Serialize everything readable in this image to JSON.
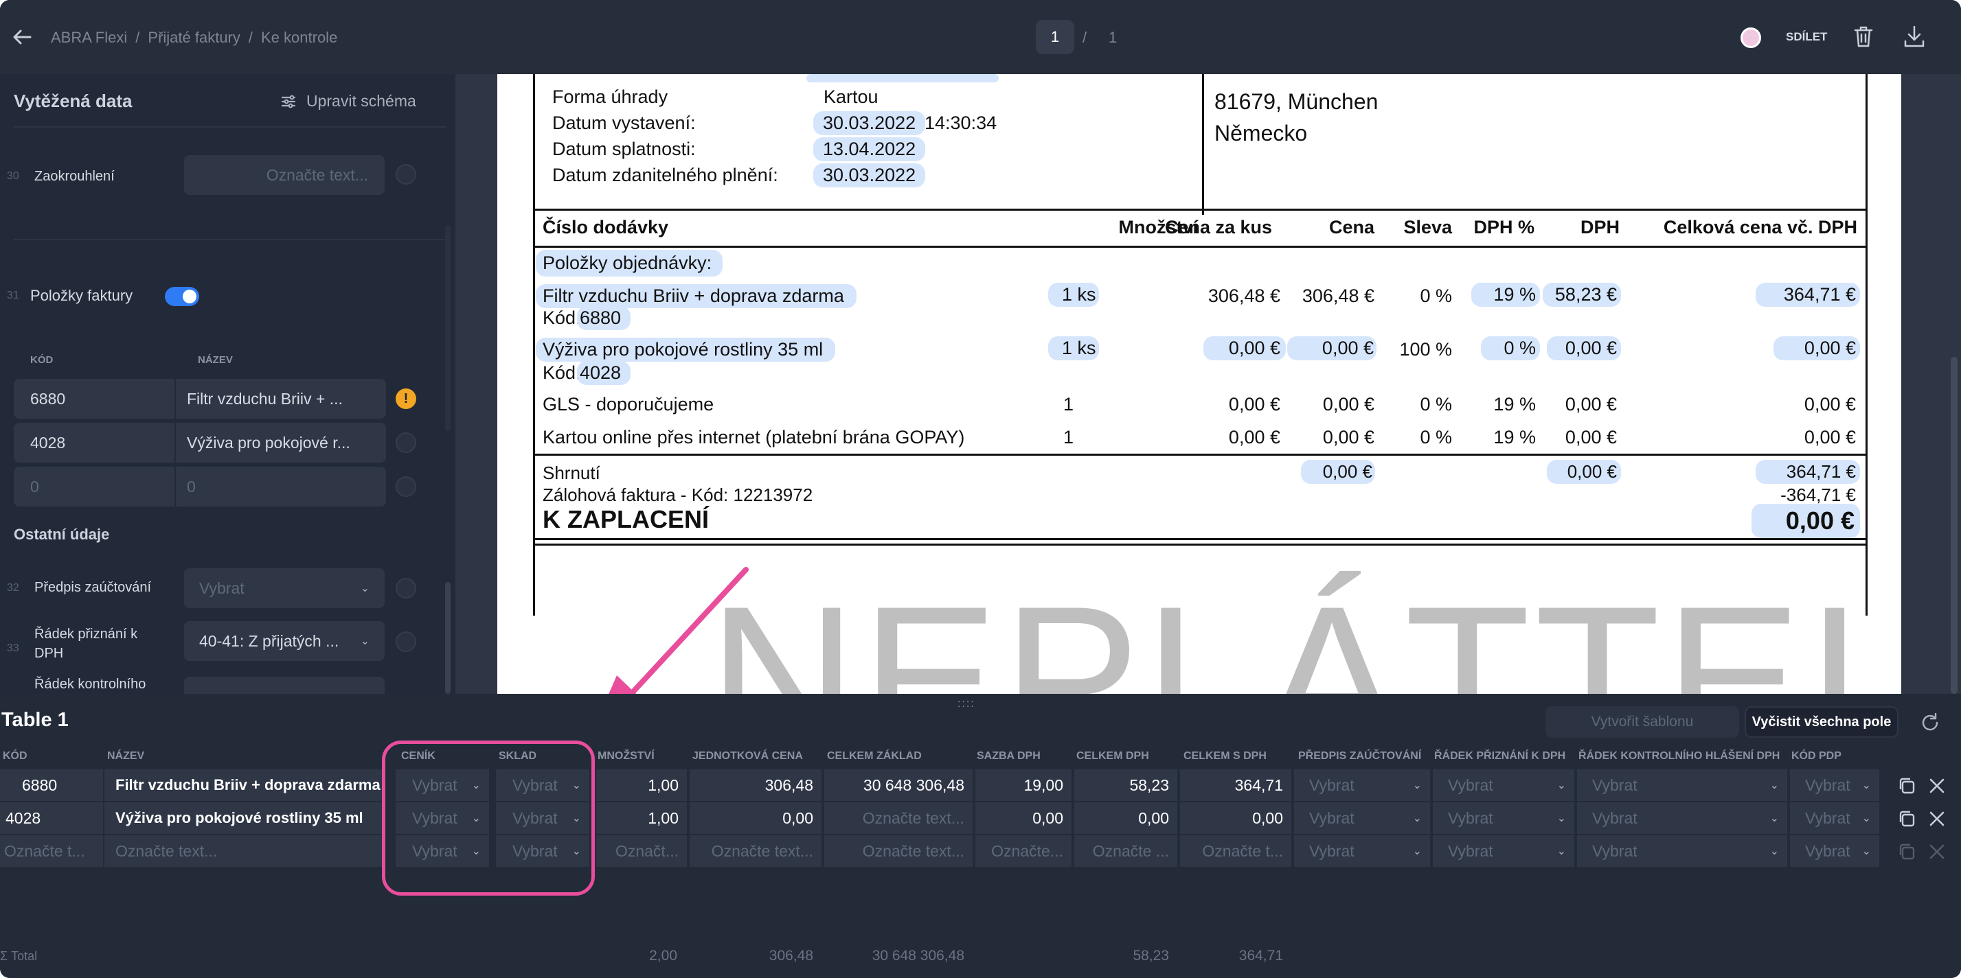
{
  "header": {
    "breadcrumb": [
      "ABRA Flexi",
      "Přijaté faktury",
      "Ke kontrole"
    ],
    "breadcrumb_sep": "/",
    "page_current": "1",
    "page_sep": "/",
    "page_total": "1",
    "share_label": "SDÍLET",
    "icons": [
      "back-arrow-icon",
      "user-avatar-icon",
      "trash-icon",
      "download-icon"
    ]
  },
  "sidebar": {
    "title": "Vytěžená data",
    "edit_schema": "Upravit schéma",
    "rounding": {
      "num": "30",
      "label": "Zaokrouhlení",
      "placeholder": "Označte text..."
    },
    "items_section": {
      "num": "31",
      "label": "Položky faktury",
      "toggle_on": true
    },
    "items_headers": {
      "code": "KÓD",
      "name": "NÁZEV"
    },
    "items": [
      {
        "code": "6880",
        "name": "Filtr vzduchu Briiv + ...",
        "warning": "!"
      },
      {
        "code": "4028",
        "name": "Výživa pro pokojové r..."
      },
      {
        "code": "0",
        "name": "0"
      }
    ],
    "other_title": "Ostatní údaje",
    "accounting": {
      "num": "32",
      "label": "Předpis zaúčtování",
      "value": "Vybrat"
    },
    "vat_line": {
      "num": "33",
      "label": "Řádek přiznání k DPH",
      "value": "40-41: Z přijatých ..."
    },
    "control_line": {
      "label": "Řádek kontrolního"
    }
  },
  "document": {
    "payment_method_label": "Forma úhrady",
    "payment_method": "Kartou",
    "issue_label": "Datum vystavení:",
    "issue_date": "30.03.2022",
    "issue_time": "14:30:34",
    "due_label": "Datum splatnosti:",
    "due_date": "13.04.2022",
    "taxable_label": "Datum zdanitelného plnění:",
    "taxable_date": "30.03.2022",
    "address_city": "81679, München",
    "address_country": "Německo",
    "table_headers": [
      "Číslo dodávky",
      "Množství",
      "Cena za kus",
      "Cena",
      "Sleva",
      "DPH %",
      "DPH",
      "Celková cena vč. DPH"
    ],
    "section_label": "Položky objednávky:",
    "rows": [
      {
        "name": "Filtr vzduchu Briiv + doprava zdarma",
        "code_label": "Kód:",
        "code": "6880",
        "qty": "1 ks",
        "unit": "306,48 €",
        "price": "306,48 €",
        "discount": "0 %",
        "vat_pct": "19 %",
        "vat": "58,23 €",
        "total": "364,71 €"
      },
      {
        "name": "Výživa pro pokojové rostliny 35 ml",
        "code_label": "Kód:",
        "code": "4028",
        "qty": "1 ks",
        "unit": "0,00 €",
        "price": "0,00 €",
        "discount": "100 %",
        "vat_pct": "0 %",
        "vat": "0,00 €",
        "total": "0,00 €"
      },
      {
        "name": "GLS - doporučujeme",
        "qty": "1",
        "unit": "0,00 €",
        "price": "0,00 €",
        "discount": "0 %",
        "vat_pct": "19 %",
        "vat": "0,00 €",
        "total": "0,00 €"
      },
      {
        "name": "Kartou online přes internet (platební brána GOPAY)",
        "qty": "1",
        "unit": "0,00 €",
        "price": "0,00 €",
        "discount": "0 %",
        "vat_pct": "19 %",
        "vat": "0,00 €",
        "total": "0,00 €"
      }
    ],
    "summary_label": "Shrnutí",
    "summary_price": "0,00 €",
    "summary_vat": "0,00 €",
    "summary_total": "364,71 €",
    "advance_label": "Zálohová faktura - Kód: 12213972",
    "advance_total": "-364,71 €",
    "pay_label": "K ZAPLACENÍ",
    "pay_total": "0,00 €",
    "watermark": "NEPLÁTTEI"
  },
  "resize_handle": "::::",
  "table": {
    "title": "Table 1",
    "create_template": "Vytvořit šablonu",
    "clear_all": "Vyčistit všechna pole",
    "columns": [
      "KÓD",
      "NÁZEV",
      "CENÍK",
      "SKLAD",
      "MNOŽSTVÍ",
      "JEDNOTKOVÁ CENA",
      "CELKEM ZÁKLAD",
      "SAZBA DPH",
      "CELKEM DPH",
      "CELKEM S DPH",
      "PŘEDPIS ZAÚČTOVÁNÍ",
      "ŘÁDEK PŘIZNÁNÍ K DPH",
      "ŘÁDEK KONTROLNÍHO HLÁŠENÍ DPH",
      "KÓD PDP"
    ],
    "rows": [
      {
        "code": "6880",
        "name": "Filtr vzduchu Briiv + doprava zdarma",
        "cenik": "Vybrat",
        "sklad": "Vybrat",
        "qty": "1,00",
        "unit": "306,48",
        "base": "30 648 306,48",
        "rate": "19,00",
        "vat": "58,23",
        "total": "364,71",
        "acc": "Vybrat",
        "vatline": "Vybrat",
        "ctrl": "Vybrat",
        "pdp": "Vybrat"
      },
      {
        "code": "4028",
        "name": "Výživa pro pokojové rostliny 35 ml",
        "cenik": "Vybrat",
        "sklad": "Vybrat",
        "qty": "1,00",
        "unit": "0,00",
        "base": "Označte text...",
        "rate": "0,00",
        "vat": "0,00",
        "total": "0,00",
        "acc": "Vybrat",
        "vatline": "Vybrat",
        "ctrl": "Vybrat",
        "pdp": "Vybrat"
      },
      {
        "code": "Označte t...",
        "name": "Označte text...",
        "cenik": "Vybrat",
        "sklad": "Vybrat",
        "qty": "Označt...",
        "unit": "Označte text...",
        "base": "Označte text...",
        "rate": "Označte...",
        "vat": "Označte ...",
        "total": "Označte t...",
        "acc": "Vybrat",
        "vatline": "Vybrat",
        "ctrl": "Vybrat",
        "pdp": "Vybrat"
      }
    ],
    "totals": {
      "label": "Σ Total",
      "qty": "2,00",
      "unit": "306,48",
      "base": "30 648 306,48",
      "vat": "58,23",
      "total": "364,71"
    }
  },
  "colors": {
    "accent_pink": "#e84e9c",
    "toggle_blue": "#2f7bf6",
    "warning": "#f3a623",
    "highlight": "#d5e5fb"
  }
}
